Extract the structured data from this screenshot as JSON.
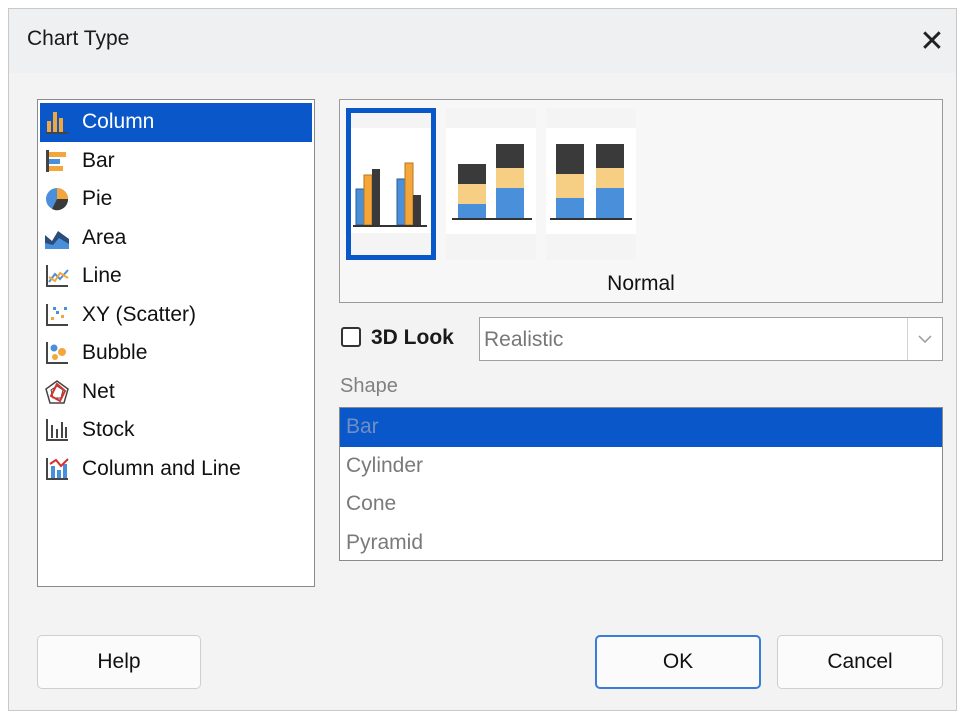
{
  "window": {
    "title": "Chart Type",
    "close_glyph": "✕"
  },
  "chart_types": [
    {
      "label": "Column",
      "icon": "column-chart-icon",
      "selected": true
    },
    {
      "label": "Bar",
      "icon": "bar-chart-icon"
    },
    {
      "label": "Pie",
      "icon": "pie-chart-icon"
    },
    {
      "label": "Area",
      "icon": "area-chart-icon"
    },
    {
      "label": "Line",
      "icon": "line-chart-icon"
    },
    {
      "label": "XY (Scatter)",
      "icon": "scatter-chart-icon"
    },
    {
      "label": "Bubble",
      "icon": "bubble-chart-icon"
    },
    {
      "label": "Net",
      "icon": "net-chart-icon"
    },
    {
      "label": "Stock",
      "icon": "stock-chart-icon"
    },
    {
      "label": "Column and Line",
      "icon": "column-line-chart-icon"
    }
  ],
  "variants": {
    "items": [
      "normal-column-icon",
      "stacked-column-icon",
      "percent-stacked-column-icon"
    ],
    "selected_index": 0,
    "selected_label": "Normal"
  },
  "look_3d": {
    "label": "3D Look",
    "checked": false,
    "select_value": "Realistic"
  },
  "shape": {
    "label": "Shape",
    "options": [
      "Bar",
      "Cylinder",
      "Cone",
      "Pyramid"
    ],
    "selected_index": 0
  },
  "buttons": {
    "help": "Help",
    "ok": "OK",
    "cancel": "Cancel"
  },
  "colors": {
    "accent": "#0a57c9",
    "orange": "#f4a63a",
    "blue": "#4a8fd9",
    "dark": "#3a3a3a",
    "light_orange": "#f7cf84"
  }
}
